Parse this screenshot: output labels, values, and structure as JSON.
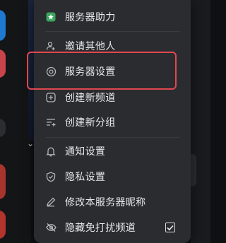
{
  "menu": {
    "items": [
      {
        "label": "服务器助力",
        "icon": "boost-badge-icon"
      },
      {
        "label": "邀请其他人",
        "icon": "person-add-icon"
      },
      {
        "label": "服务器设置",
        "icon": "settings-gear-icon"
      },
      {
        "label": "创建新频道",
        "icon": "plus-circle-icon"
      },
      {
        "label": "创建新分组",
        "icon": "new-category-icon"
      },
      {
        "label": "通知设置",
        "icon": "bell-icon"
      },
      {
        "label": "隐私设置",
        "icon": "shield-icon"
      },
      {
        "label": "修改本服务器昵称",
        "icon": "pencil-icon"
      },
      {
        "label": "隐藏免打扰频道",
        "icon": "eye-slash-icon",
        "checked": true
      }
    ]
  },
  "colors": {
    "menu_bg": "#2b2c30",
    "text": "#e8e8ea",
    "icon": "#b5b6ba",
    "boost_icon": "#3ba55d",
    "highlight": "#e0474f"
  }
}
